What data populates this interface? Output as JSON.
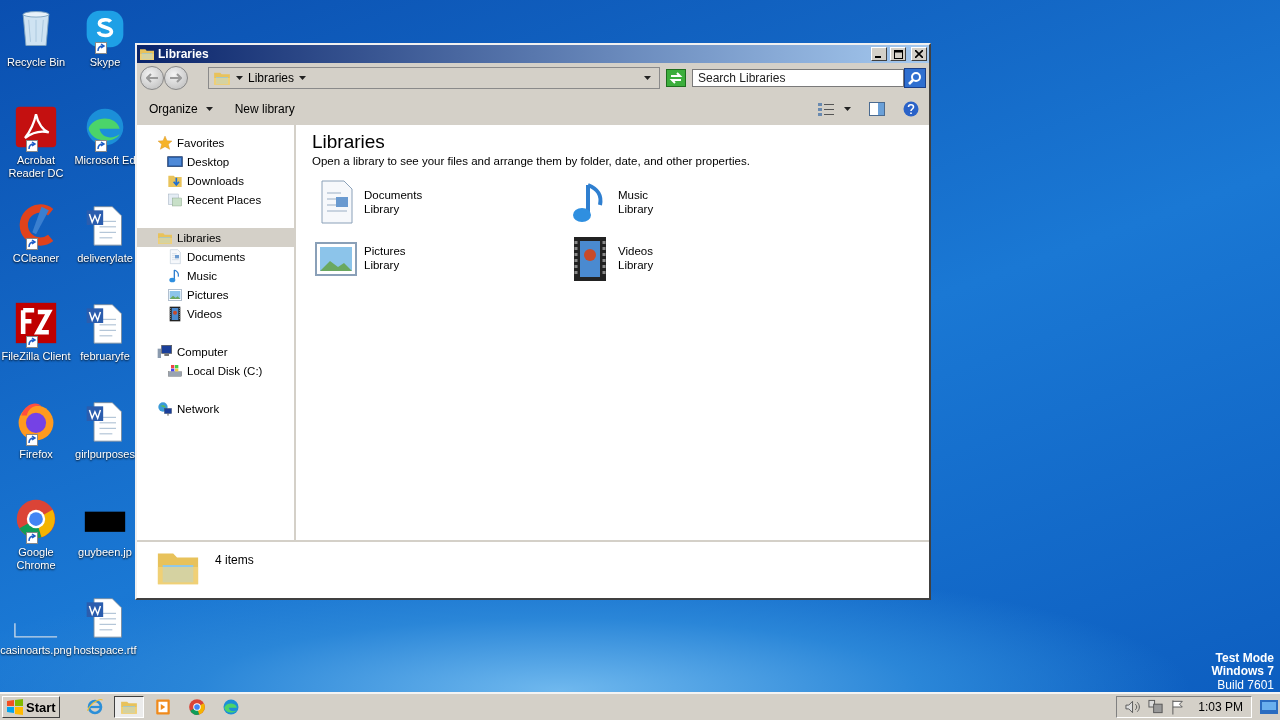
{
  "desktop": {
    "icons": [
      {
        "label": "Recycle Bin",
        "kind": "recycle",
        "shortcut": false
      },
      {
        "label": "Skype",
        "kind": "skype",
        "shortcut": true
      },
      {
        "label": "Acrobat Reader DC",
        "kind": "acrobat",
        "shortcut": true
      },
      {
        "label": "Microsoft Ed",
        "kind": "edge",
        "shortcut": true
      },
      {
        "label": "CCleaner",
        "kind": "ccleaner",
        "shortcut": true
      },
      {
        "label": "deliverylate",
        "kind": "word",
        "shortcut": false
      },
      {
        "label": "FileZilla Client",
        "kind": "filezilla",
        "shortcut": true
      },
      {
        "label": "februaryfe",
        "kind": "word",
        "shortcut": false
      },
      {
        "label": "Firefox",
        "kind": "firefox",
        "shortcut": true
      },
      {
        "label": "girlpurposes",
        "kind": "word",
        "shortcut": false
      },
      {
        "label": "Google Chrome",
        "kind": "chrome",
        "shortcut": true
      },
      {
        "label": "guybeen.jp",
        "kind": "black",
        "shortcut": false
      },
      {
        "label": "casinoarts.png",
        "kind": "blank",
        "shortcut": false
      },
      {
        "label": "hostspace.rtf",
        "kind": "word",
        "shortcut": false
      }
    ],
    "system_text": [
      "Test Mode",
      "Windows 7",
      "Build 7601"
    ]
  },
  "window": {
    "title": "Libraries",
    "address": {
      "path": "Libraries"
    },
    "search": {
      "placeholder": "Search Libraries"
    },
    "toolbar": [
      {
        "label": "Organize",
        "kind": "menu"
      },
      {
        "label": "New library",
        "kind": "plain"
      }
    ],
    "nav": [
      {
        "label": "Favorites",
        "kind": "star",
        "selected": false,
        "children": [
          {
            "label": "Desktop",
            "kind": "desktop",
            "selected": false
          },
          {
            "label": "Downloads",
            "kind": "downloads",
            "selected": false
          },
          {
            "label": "Recent Places",
            "kind": "recent",
            "selected": false
          }
        ]
      },
      {
        "label": "Libraries",
        "kind": "library",
        "selected": true,
        "children": [
          {
            "label": "Documents",
            "kind": "documents",
            "selected": false
          },
          {
            "label": "Music",
            "kind": "music",
            "selected": false
          },
          {
            "label": "Pictures",
            "kind": "pictures",
            "selected": false
          },
          {
            "label": "Videos",
            "kind": "videos",
            "selected": false
          }
        ]
      },
      {
        "label": "Computer",
        "kind": "computer",
        "selected": false,
        "children": [
          {
            "label": "Local Disk (C:)",
            "kind": "disk",
            "selected": false
          }
        ]
      },
      {
        "label": "Network",
        "kind": "network",
        "selected": false
      }
    ],
    "heading": "Libraries",
    "description": "Open a library to see your files and arrange them by folder, date, and other properties.",
    "libraries": [
      {
        "name": "Documents",
        "subtitle": "Library",
        "kind": "documents"
      },
      {
        "name": "Music",
        "subtitle": "Library",
        "kind": "music"
      },
      {
        "name": "Pictures",
        "subtitle": "Library",
        "kind": "pictures"
      },
      {
        "name": "Videos",
        "subtitle": "Library",
        "kind": "videos"
      }
    ],
    "details": "4 items"
  },
  "taskbar": {
    "start": "Start",
    "apps": [
      {
        "kind": "ie",
        "active": false
      },
      {
        "kind": "explorer",
        "active": true
      },
      {
        "kind": "media",
        "active": false
      },
      {
        "kind": "chrome",
        "active": false
      },
      {
        "kind": "edge",
        "active": false
      }
    ],
    "clock": "1:03 PM"
  }
}
